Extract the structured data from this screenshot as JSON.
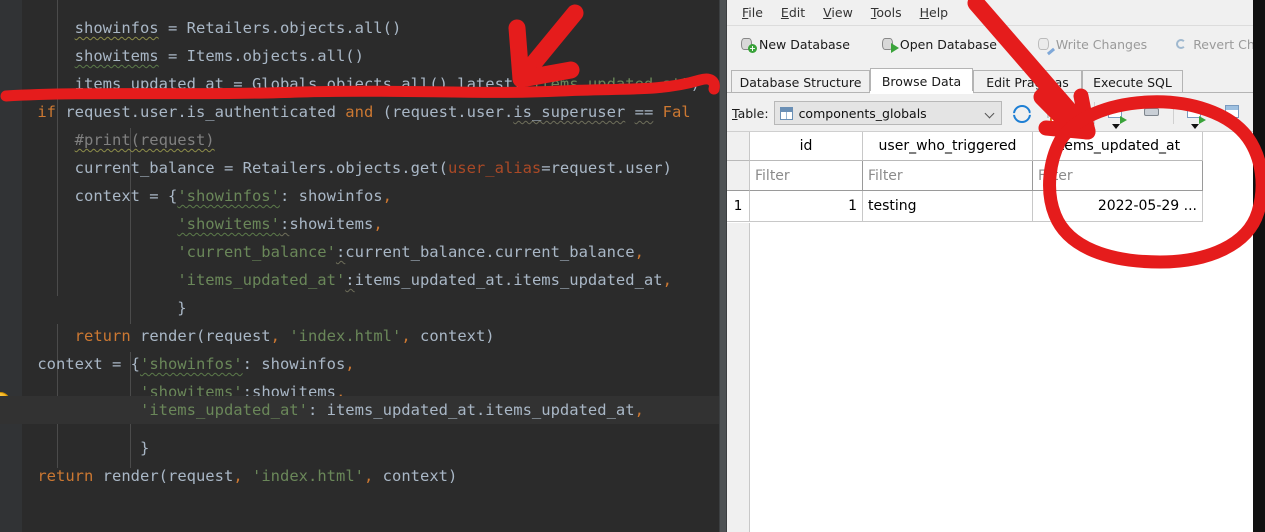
{
  "editor": {
    "language": "python",
    "theme": "darcula",
    "background": "#2b2b2b",
    "gutter_background": "#313335",
    "intention_icon": "lightbulb-icon",
    "lines": [
      "        showinfos = Retailers.objects.all()",
      "        showitems = Items.objects.all()",
      "        items_updated_at = Globals.objects.all().latest(\"items_updated_at\")",
      "    if request.user.is_authenticated and (request.user.is_superuser == Fal",
      "        #print(request)",
      "        current_balance = Retailers.objects.get(user_alias=request.user)",
      "        context = {'showinfos': showinfos,",
      "                   'showitems':showitems,",
      "                   'current_balance':current_balance.current_balance,",
      "                   'items_updated_at':items_updated_at.items_updated_at,",
      "                   }",
      "        return render(request, 'index.html', context)",
      "    context = {'showinfos': showinfos,",
      "               'showitems':showitems,",
      "               'items_updated_at': items_updated_at.items_updated_at,",
      "               }",
      "    return render(request, 'index.html', context)"
    ],
    "highlighted_line_index": 14
  },
  "dbwin": {
    "title": "DB Browser for SQLite",
    "menu": [
      {
        "label": "File",
        "mnemonic": "F"
      },
      {
        "label": "Edit",
        "mnemonic": "E"
      },
      {
        "label": "View",
        "mnemonic": "V"
      },
      {
        "label": "Tools",
        "mnemonic": "T"
      },
      {
        "label": "Help",
        "mnemonic": "H"
      }
    ],
    "toolbar": [
      {
        "label": "New Database",
        "icon": "new-database-icon",
        "enabled": true
      },
      {
        "label": "Open Database",
        "icon": "open-database-icon",
        "enabled": true,
        "has_dropdown": true
      },
      {
        "label": "Write Changes",
        "icon": "write-changes-icon",
        "enabled": false
      },
      {
        "label": "Revert Changes",
        "icon": "revert-changes-icon",
        "enabled": false
      }
    ],
    "tabs": [
      {
        "label": "Database Structure",
        "active": false
      },
      {
        "label": "Browse Data",
        "active": true
      },
      {
        "label": "Edit Pragmas",
        "active": false
      },
      {
        "label": "Execute SQL",
        "active": false
      }
    ],
    "table_selector": {
      "label": "Table:",
      "mnemonic": "T",
      "value": "components_globals",
      "icon": "table-icon",
      "caret": "chevron-down-icon"
    },
    "grid_tools": [
      {
        "icon": "refresh-icon",
        "name": "refresh"
      },
      {
        "icon": "clear-filters-icon",
        "name": "clear-filters"
      },
      {
        "icon": "clear-sorting-icon",
        "name": "clear-sorting"
      },
      {
        "icon": "insert-record-icon",
        "name": "insert-record"
      },
      {
        "icon": "print-icon",
        "name": "print"
      },
      {
        "icon": "new-record-icon",
        "name": "new-record"
      },
      {
        "icon": "column-display-icon",
        "name": "column-display"
      }
    ],
    "grid": {
      "columns": [
        "id",
        "user_who_triggered",
        "items_updated_at"
      ],
      "filter_placeholder": "Filter",
      "rows": [
        {
          "num": "1",
          "id": "1",
          "user_who_triggered": "testing",
          "items_updated_at": "2022-05-29 ..."
        }
      ]
    }
  },
  "annotations": {
    "color": "#e51c1c",
    "marks": [
      {
        "name": "arrow-pointing-to-items-updated-at-code",
        "type": "arrow"
      },
      {
        "name": "underline-under-items-updated-at-line",
        "type": "underline"
      },
      {
        "name": "arrow-pointing-to-items-updated-at-column",
        "type": "arrow"
      },
      {
        "name": "ellipse-around-items-updated-at-column",
        "type": "ellipse"
      }
    ]
  }
}
